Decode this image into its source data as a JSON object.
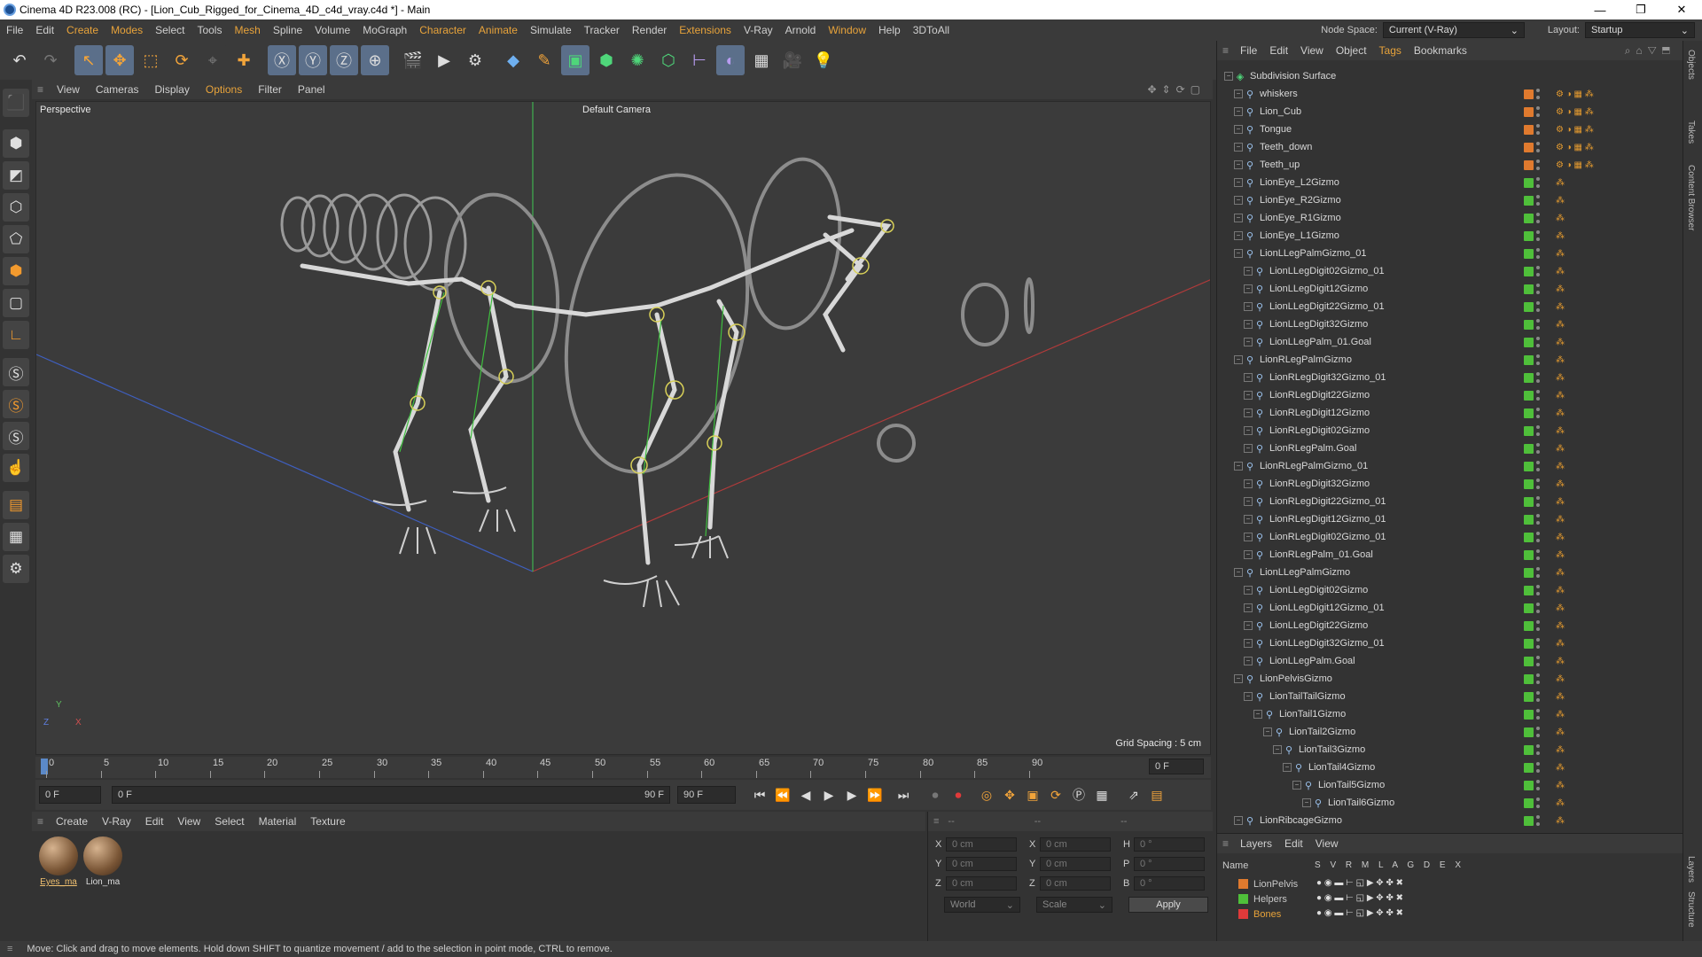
{
  "titlebar": {
    "title": "Cinema 4D R23.008 (RC) - [Lion_Cub_Rigged_for_Cinema_4D_c4d_vray.c4d *] - Main",
    "minimize": "—",
    "maximize": "❐",
    "close": "✕"
  },
  "menu": {
    "items": [
      "File",
      "Edit",
      "Create",
      "Modes",
      "Select",
      "Tools",
      "Mesh",
      "Spline",
      "Volume",
      "MoGraph",
      "Character",
      "Animate",
      "Simulate",
      "Tracker",
      "Render",
      "Extensions",
      "V-Ray",
      "Arnold",
      "Window",
      "Help",
      "3DToAll"
    ],
    "node_space_label": "Node Space:",
    "node_space_value": "Current (V-Ray)",
    "layout_label": "Layout:",
    "layout_value": "Startup"
  },
  "viewport": {
    "menu": [
      "View",
      "Cameras",
      "Display",
      "Options",
      "Filter",
      "Panel"
    ],
    "name": "Perspective",
    "camera": "Default Camera",
    "grid_spacing": "Grid Spacing : 5 cm",
    "axis_y": "Y",
    "axis_x": "X",
    "axis_z": "Z"
  },
  "timeline": {
    "ticks": [
      "0",
      "5",
      "10",
      "15",
      "20",
      "25",
      "30",
      "35",
      "40",
      "45",
      "50",
      "55",
      "60",
      "65",
      "70",
      "75",
      "80",
      "85",
      "90"
    ],
    "current_frame_right": "0 F"
  },
  "transport": {
    "start_field": "0 F",
    "preview_start": "0 F",
    "preview_end": "90 F",
    "end_field": "90 F"
  },
  "material_manager": {
    "menu": [
      "Create",
      "V-Ray",
      "Edit",
      "View",
      "Select",
      "Material",
      "Texture"
    ],
    "materials": [
      "Eyes_ma",
      "Lion_ma"
    ]
  },
  "coordinates": {
    "header_left": "--",
    "header_mid": "--",
    "header_right": "--",
    "x_pos": "0 cm",
    "y_pos": "0 cm",
    "z_pos": "0 cm",
    "x_size": "0 cm",
    "y_size": "0 cm",
    "z_size": "0 cm",
    "h": "0 °",
    "p": "0 °",
    "b": "0 °",
    "labels": {
      "x": "X",
      "y": "Y",
      "z": "Z",
      "h": "H",
      "p": "P",
      "b": "B"
    },
    "mode_world": "World",
    "mode_scale": "Scale",
    "apply": "Apply"
  },
  "object_manager": {
    "menu": [
      "File",
      "Edit",
      "View",
      "Object",
      "Tags",
      "Bookmarks"
    ],
    "objects": [
      {
        "name": "Subdivision Surface",
        "depth": 0,
        "color": "#888888"
      },
      {
        "name": "whiskers",
        "depth": 1,
        "color": "#e07a2e"
      },
      {
        "name": "Lion_Cub",
        "depth": 1,
        "color": "#e07a2e"
      },
      {
        "name": "Tongue",
        "depth": 1,
        "color": "#e07a2e"
      },
      {
        "name": "Teeth_down",
        "depth": 1,
        "color": "#e07a2e"
      },
      {
        "name": "Teeth_up",
        "depth": 1,
        "color": "#e07a2e"
      },
      {
        "name": "LionEye_L2Gizmo",
        "depth": 1,
        "color": "#4fbf3a"
      },
      {
        "name": "LionEye_R2Gizmo",
        "depth": 1,
        "color": "#4fbf3a"
      },
      {
        "name": "LionEye_R1Gizmo",
        "depth": 1,
        "color": "#4fbf3a"
      },
      {
        "name": "LionEye_L1Gizmo",
        "depth": 1,
        "color": "#4fbf3a"
      },
      {
        "name": "LionLLegPalmGizmo_01",
        "depth": 1,
        "color": "#4fbf3a"
      },
      {
        "name": "LionLLegDigit02Gizmo_01",
        "depth": 2,
        "color": "#4fbf3a"
      },
      {
        "name": "LionLLegDigit12Gizmo",
        "depth": 2,
        "color": "#4fbf3a"
      },
      {
        "name": "LionLLegDigit22Gizmo_01",
        "depth": 2,
        "color": "#4fbf3a"
      },
      {
        "name": "LionLLegDigit32Gizmo",
        "depth": 2,
        "color": "#4fbf3a"
      },
      {
        "name": "LionLLegPalm_01.Goal",
        "depth": 2,
        "color": "#4fbf3a"
      },
      {
        "name": "LionRLegPalmGizmo",
        "depth": 1,
        "color": "#4fbf3a"
      },
      {
        "name": "LionRLegDigit32Gizmo_01",
        "depth": 2,
        "color": "#4fbf3a"
      },
      {
        "name": "LionRLegDigit22Gizmo",
        "depth": 2,
        "color": "#4fbf3a"
      },
      {
        "name": "LionRLegDigit12Gizmo",
        "depth": 2,
        "color": "#4fbf3a"
      },
      {
        "name": "LionRLegDigit02Gizmo",
        "depth": 2,
        "color": "#4fbf3a"
      },
      {
        "name": "LionRLegPalm.Goal",
        "depth": 2,
        "color": "#4fbf3a"
      },
      {
        "name": "LionRLegPalmGizmo_01",
        "depth": 1,
        "color": "#4fbf3a"
      },
      {
        "name": "LionRLegDigit32Gizmo",
        "depth": 2,
        "color": "#4fbf3a"
      },
      {
        "name": "LionRLegDigit22Gizmo_01",
        "depth": 2,
        "color": "#4fbf3a"
      },
      {
        "name": "LionRLegDigit12Gizmo_01",
        "depth": 2,
        "color": "#4fbf3a"
      },
      {
        "name": "LionRLegDigit02Gizmo_01",
        "depth": 2,
        "color": "#4fbf3a"
      },
      {
        "name": "LionRLegPalm_01.Goal",
        "depth": 2,
        "color": "#4fbf3a"
      },
      {
        "name": "LionLLegPalmGizmo",
        "depth": 1,
        "color": "#4fbf3a"
      },
      {
        "name": "LionLLegDigit02Gizmo",
        "depth": 2,
        "color": "#4fbf3a"
      },
      {
        "name": "LionLLegDigit12Gizmo_01",
        "depth": 2,
        "color": "#4fbf3a"
      },
      {
        "name": "LionLLegDigit22Gizmo",
        "depth": 2,
        "color": "#4fbf3a"
      },
      {
        "name": "LionLLegDigit32Gizmo_01",
        "depth": 2,
        "color": "#4fbf3a"
      },
      {
        "name": "LionLLegPalm.Goal",
        "depth": 2,
        "color": "#4fbf3a"
      },
      {
        "name": "LionPelvisGizmo",
        "depth": 1,
        "color": "#4fbf3a"
      },
      {
        "name": "LionTailTailGizmo",
        "depth": 2,
        "color": "#4fbf3a"
      },
      {
        "name": "LionTail1Gizmo",
        "depth": 3,
        "color": "#4fbf3a"
      },
      {
        "name": "LionTail2Gizmo",
        "depth": 4,
        "color": "#4fbf3a"
      },
      {
        "name": "LionTail3Gizmo",
        "depth": 5,
        "color": "#4fbf3a"
      },
      {
        "name": "LionTail4Gizmo",
        "depth": 6,
        "color": "#4fbf3a"
      },
      {
        "name": "LionTail5Gizmo",
        "depth": 7,
        "color": "#4fbf3a"
      },
      {
        "name": "LionTail6Gizmo",
        "depth": 8,
        "color": "#4fbf3a"
      },
      {
        "name": "LionRibcageGizmo",
        "depth": 1,
        "color": "#4fbf3a"
      }
    ]
  },
  "layers": {
    "menu": [
      "Layers",
      "Edit",
      "View"
    ],
    "header_name": "Name",
    "header_flags": "S V R M L A G D E X",
    "items": [
      {
        "name": "LionPelvis",
        "color": "#e07a2e"
      },
      {
        "name": "Helpers",
        "color": "#4fbf3a"
      },
      {
        "name": "Bones",
        "color": "#e03a3a"
      }
    ]
  },
  "right_tabs": [
    "Objects",
    "Takes",
    "Content Browser",
    "Layers",
    "Structure"
  ],
  "status": "Move: Click and drag to move elements. Hold down SHIFT to quantize movement / add to the selection in point mode, CTRL to remove.",
  "colors": {
    "accent": "#e8a33a",
    "bg": "#333333",
    "panel": "#3a3a3a"
  }
}
